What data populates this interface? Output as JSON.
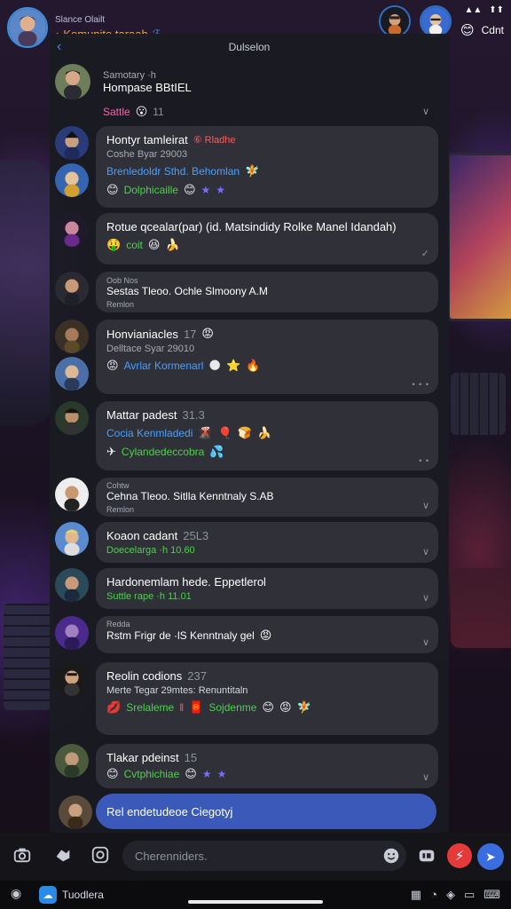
{
  "status": {
    "subtitle": "Slance Olailt",
    "title": "Komunite taraah",
    "right_label": "Cdnt",
    "clock_hint": "··· ··· ···"
  },
  "panel": {
    "header": "Dulselon",
    "back": "‹"
  },
  "messages": [
    {
      "name": "Samotary ·h",
      "meta": "Hompase BBtIEL",
      "line": "Sattle",
      "line_color": "pink",
      "extra": "11"
    },
    {
      "name": "Hontyr tamleirat",
      "tag": "⑥ Rladhe",
      "meta": "Coshe Byar 29003",
      "line": "Brenledoldr Sthd. Behomlan",
      "line2": "Dolphicaille",
      "line2_color": "green"
    },
    {
      "name": "Rotue qcealar(par) (id. Matsindidy Rolke Manel Idandah)",
      "line": "coit",
      "line_color": "green"
    },
    {
      "name": "Oob Nos",
      "meta": "Sestas Tleoo. Ochle Slmoony A.M",
      "meta2": "Remlon"
    },
    {
      "name": "Honvianiacles",
      "extra": "17",
      "meta": "Delltace Syar 29010",
      "line": "Avrlar Kormenarl",
      "line_color": "blue"
    },
    {
      "name": "Mattar padest",
      "extra": "31.3",
      "line": "Cocia Kenmladedi",
      "line_color": "blue",
      "line2": "Cylandedeccobra",
      "line2_color": "green"
    },
    {
      "name": "Cohtw",
      "meta": "Cehna Tleoo. Sitlla Kenntnaly S.AB",
      "meta2": "Remlon"
    },
    {
      "name": "Koaon cadant",
      "extra": "25L3",
      "meta": "Doecelarga ·h 10.60",
      "meta_color": "green"
    },
    {
      "name": "Hardonemlam hede. Eppetlerol",
      "meta": "Suttle rape ·h 11.01",
      "meta_color": "green"
    },
    {
      "name": "Redda",
      "meta": "Rstm Frigr de ·lS Kenntnaly gel",
      "meta_strong": true
    },
    {
      "name": "Reolin codions",
      "extra": "237",
      "meta": "Merte Tegar 29mtes: Renuntitaln",
      "line": "Srelaleme",
      "line_color": "green",
      "line3": "Sojdenme",
      "line3_color": "green"
    },
    {
      "name": "Tlakar pdeinst",
      "extra": "15",
      "line": "Cvtphichiae",
      "line_color": "green"
    }
  ],
  "compose_pill": "Rel endetudeoe Ciegotyj",
  "composer": {
    "placeholder": "Cherenniders."
  },
  "sysbar": {
    "app_label": "Tuodlera"
  }
}
